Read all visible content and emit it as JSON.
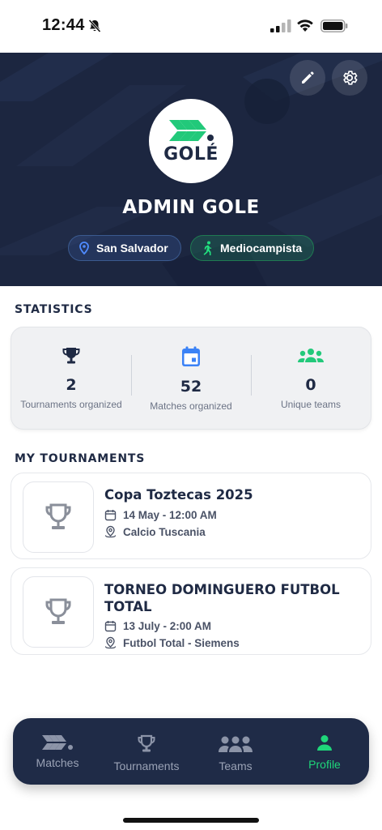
{
  "status_bar": {
    "time": "12:44"
  },
  "header": {
    "logo_text": "GOLÉ",
    "profile_name": "ADMIN GOLE",
    "location": "San Salvador",
    "position": "Mediocampista",
    "icons": {
      "edit": "pencil-icon",
      "settings": "gear-icon"
    }
  },
  "statistics": {
    "title": "STATISTICS",
    "items": [
      {
        "value": "2",
        "label": "Tournaments organized",
        "icon": "trophy-icon",
        "color": "#1f2a44"
      },
      {
        "value": "52",
        "label": "Matches organized",
        "icon": "calendar-icon",
        "color": "#3b82f6"
      },
      {
        "value": "0",
        "label": "Unique teams",
        "icon": "group-icon",
        "color": "#22c97a"
      }
    ]
  },
  "my_tournaments": {
    "title": "MY TOURNAMENTS",
    "items": [
      {
        "name": "Copa Toztecas 2025",
        "date": "14 May - 12:00 AM",
        "venue": "Calcio Tuscania"
      },
      {
        "name": "TORNEO DOMINGUERO FUTBOL TOTAL",
        "date": "13 July - 2:00 AM",
        "venue": "Futbol Total - Siemens"
      }
    ]
  },
  "bottom_nav": {
    "items": [
      {
        "label": "Matches",
        "icon": "gole-logo-icon",
        "active": false
      },
      {
        "label": "Tournaments",
        "icon": "trophy-icon",
        "active": false
      },
      {
        "label": "Teams",
        "icon": "group-icon",
        "active": false
      },
      {
        "label": "Profile",
        "icon": "person-icon",
        "active": true
      }
    ]
  },
  "colors": {
    "header_bg": "#1c2640",
    "accent_green": "#1fd67a",
    "nav_bg": "#1f2b47",
    "accent_blue": "#3b82f6"
  }
}
